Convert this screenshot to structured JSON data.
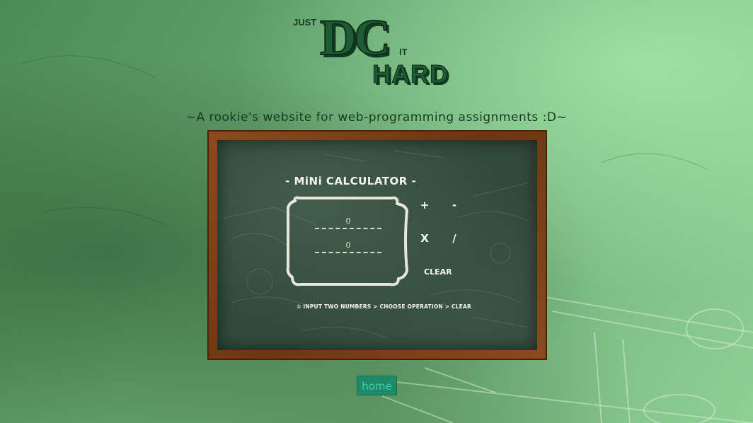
{
  "logo": {
    "just": "JUST",
    "dc": "DC",
    "it": "IT",
    "hard": "HARD"
  },
  "tagline": "~A rookie's website for web-programming assignments :D~",
  "calculator": {
    "title": "- MiNi CALCULATOR -",
    "input_a": {
      "value": "",
      "placeholder": "0"
    },
    "input_b": {
      "value": "",
      "placeholder": "0"
    },
    "operations": {
      "add": "+",
      "subtract": "-",
      "multiply": "X",
      "divide": "/"
    },
    "clear_label": "CLEAR",
    "instructions": "① INPUT TWO NUMBERS > CHOOSE OPERATION > CLEAR"
  },
  "nav": {
    "home_label": "home"
  },
  "colors": {
    "background": "#69a873",
    "chalkboard": "#324a3b",
    "frame": "#6b3612",
    "chalk": "#f4f4ec",
    "home_button": "#1d8a6a",
    "home_text": "#3fd0a4",
    "logo": "#1f5c35"
  }
}
